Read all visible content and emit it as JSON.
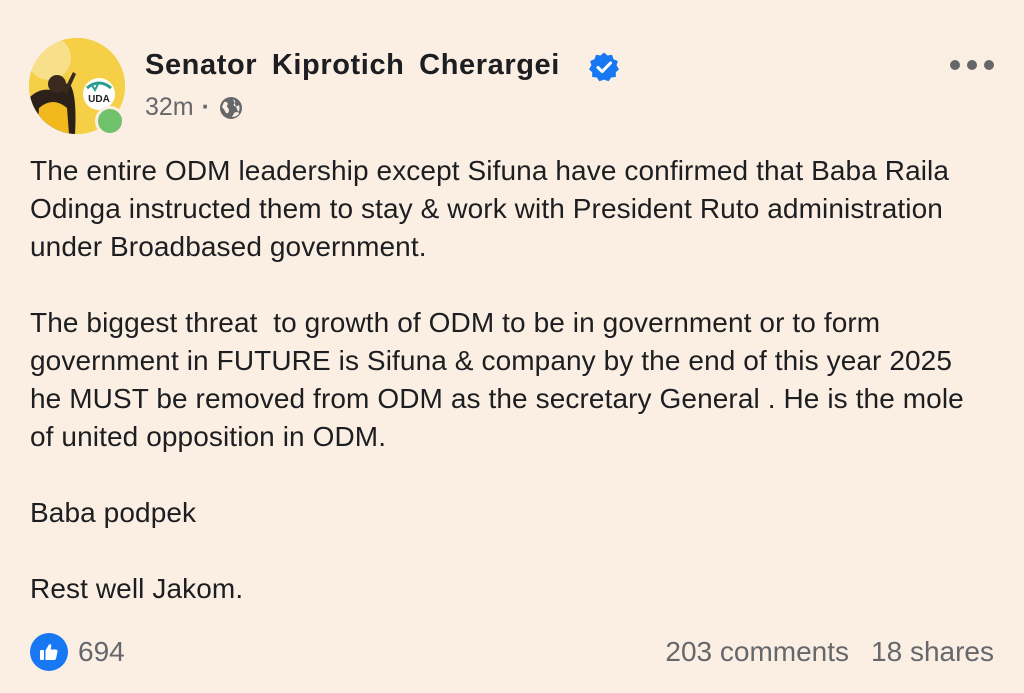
{
  "post": {
    "author": "Senator  Kiprotich  Cherargei",
    "time": "32m",
    "separator": "·",
    "audience_icon": "globe-icon",
    "verified_icon": "verified-badge-icon",
    "avatar_text": "UDA",
    "paragraphs": [
      "The entire ODM leadership except Sifuna have confirmed that Baba Raila Odinga instructed them to stay & work with President Ruto administration under Broadbased government.",
      "The biggest threat  to growth of ODM to be in government or to form government in FUTURE is Sifuna & company by the end of this year 2025 he MUST be removed from ODM as the secretary General . He is the mole of united opposition in ODM.",
      "Baba podpek",
      "Rest well Jakom."
    ],
    "reactions_count": "694",
    "comments": "203 comments",
    "shares": "18 shares"
  },
  "colors": {
    "background": "#fbeee3",
    "text": "#1c1e21",
    "secondary": "#65676b",
    "accent": "#1877f2",
    "verified": "#1877f2",
    "online": "#6fc16b"
  }
}
